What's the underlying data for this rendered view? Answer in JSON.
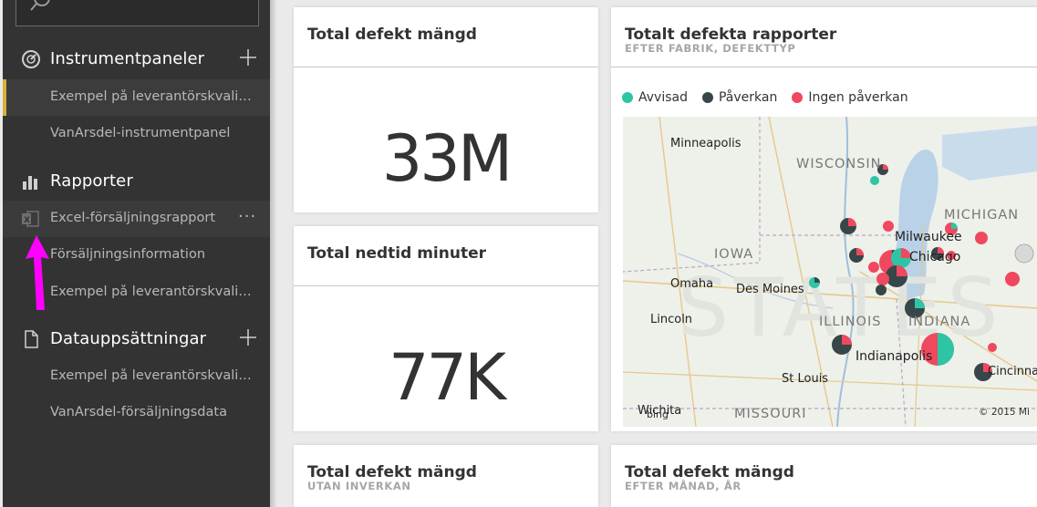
{
  "sidebar": {
    "sections": [
      {
        "title": "Instrumentpaneler",
        "icon": "gauge-icon"
      },
      {
        "title": "Rapporter",
        "icon": "bar-chart-icon"
      },
      {
        "title": "Datauppsättningar",
        "icon": "document-icon"
      }
    ],
    "dashboards": [
      "Exempel på leverantörskvalitet",
      "VanArsdel-instrumentpanel"
    ],
    "reports": [
      "Excel-försäljningsrapport",
      "Försäljningsinformation",
      "Exempel på leverantörskvalitet"
    ],
    "datasets": [
      "Exempel på leverantörskvalitet",
      "VanArsdel-försäljningsdata"
    ],
    "more": "···"
  },
  "tiles": {
    "t1": {
      "title": "Total defekt mängd",
      "value": "33M"
    },
    "t2": {
      "title": "Total nedtid minuter",
      "value": "77K"
    },
    "t3": {
      "title": "Total defekt mängd",
      "subtitle": "UTAN INVERKAN"
    },
    "t4": {
      "title": "Total defekt mängd",
      "subtitle": "EFTER MÅNAD, ÅR"
    },
    "map": {
      "title": "Totalt defekta rapporter",
      "subtitle": "EFTER FABRIK, DEFEKTTYP",
      "legend": [
        {
          "label": "Avvisad",
          "color": "#2ec5a4"
        },
        {
          "label": "Påverkan",
          "color": "#374649"
        },
        {
          "label": "Ingen påverkan",
          "color": "#f0485f"
        }
      ],
      "states": [
        "WISCONSIN",
        "MICHIGAN",
        "IOWA",
        "ILLINOIS",
        "INDIANA",
        "MISSOURI"
      ],
      "cities": [
        "Minneapolis",
        "Milwaukee",
        "Chicago",
        "Omaha",
        "Des Moines",
        "Lincoln",
        "Indianapolis",
        "St Louis",
        "Cincinnati",
        "Wichita"
      ],
      "watermark": "STATES",
      "copyright": "© 2015 Mi",
      "bing": "bing"
    }
  },
  "colors": {
    "accent": "#d6b13a",
    "arrow": "#ff00ff",
    "sidebar": "#333333"
  }
}
